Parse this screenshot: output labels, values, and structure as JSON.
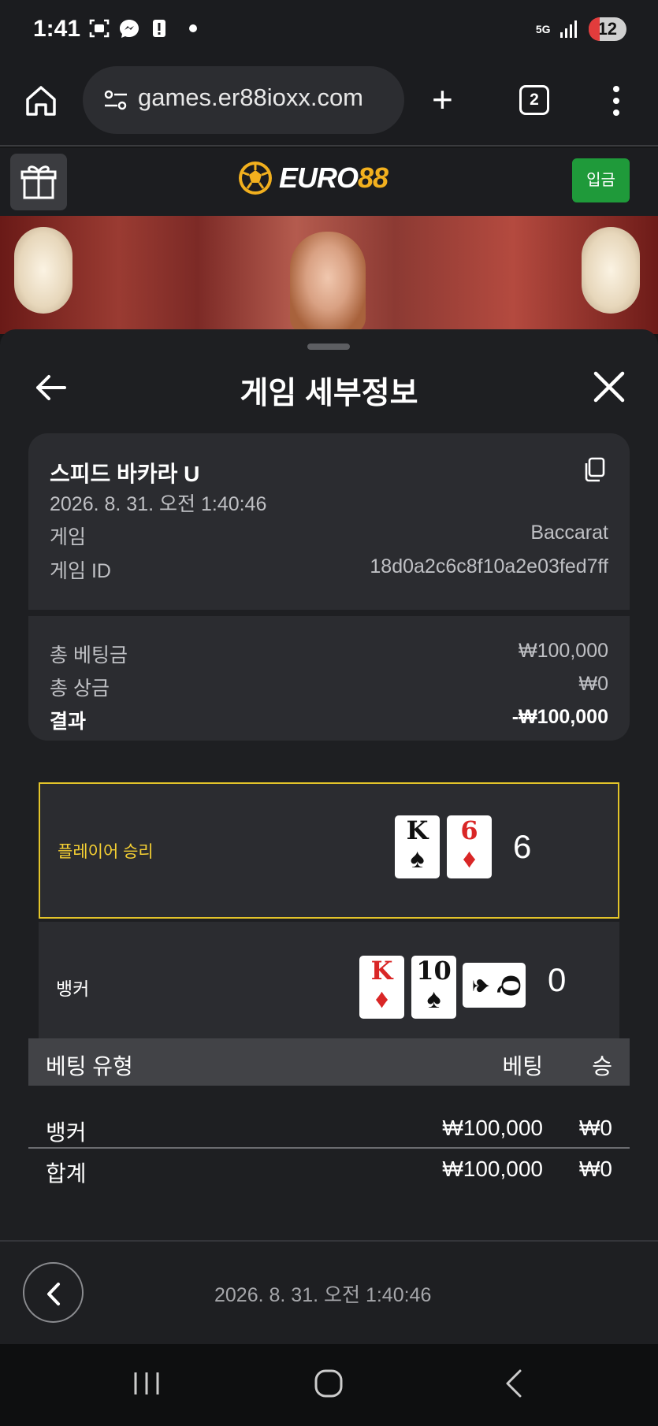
{
  "status_bar": {
    "time": "1:41",
    "network": "5G",
    "battery": "12"
  },
  "browser": {
    "url": "games.er88ioxx.com",
    "tab_count": "2"
  },
  "site": {
    "logo_main": "EURO",
    "logo_accent": "88",
    "deposit_label": "입금"
  },
  "sheet": {
    "title": "게임 세부정보",
    "game_name": "스피드 바카라 U",
    "datetime": "2026. 8. 31. 오전 1:40:46",
    "rows": [
      {
        "label": "게임",
        "value": "Baccarat"
      },
      {
        "label": "게임 ID",
        "value": "18d0a2c6c8f10a2e03fed7ff"
      }
    ],
    "totals": [
      {
        "label": "총 베팅금",
        "value": "₩100,000"
      },
      {
        "label": "총 상금",
        "value": "₩0"
      },
      {
        "label": "결과",
        "value": "-₩100,000"
      }
    ]
  },
  "results": {
    "player": {
      "label": "플레이어 승리",
      "score": "6",
      "cards": [
        {
          "rank": "K",
          "suit": "♠"
        },
        {
          "rank": "6",
          "suit": "♦"
        }
      ]
    },
    "banker": {
      "label": "뱅커",
      "score": "0",
      "cards": [
        {
          "rank": "K",
          "suit": "♦"
        },
        {
          "rank": "10",
          "suit": "♠"
        },
        {
          "rank": "Q",
          "suit": "♠"
        }
      ]
    }
  },
  "bet_table": {
    "headers": [
      "베팅 유형",
      "베팅",
      "승"
    ],
    "rows": [
      [
        "뱅커",
        "₩100,000",
        "₩0"
      ]
    ],
    "total": [
      "합계",
      "₩100,000",
      "₩0"
    ]
  },
  "footer": {
    "datetime": "2026. 8. 31. 오전 1:40:46"
  },
  "colors": {
    "accent_yellow": "#e3c42a",
    "deposit_green": "#1f9a3a",
    "logo_gold": "#f2b01e"
  }
}
